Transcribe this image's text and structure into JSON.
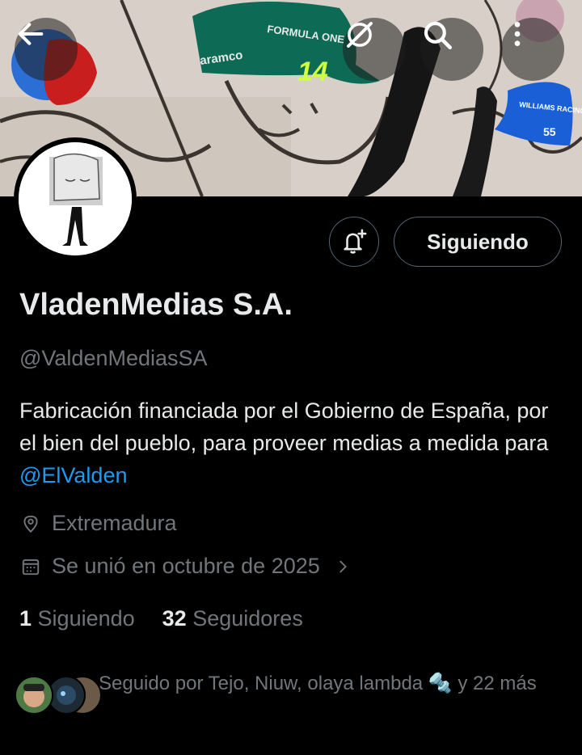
{
  "header": {
    "back_icon": "arrow-left-icon",
    "grok_icon": "grok-icon",
    "search_icon": "search-icon",
    "more_icon": "more-vertical-icon"
  },
  "banner": {
    "cap_text": "FORMULA ONE",
    "cap_sponsor": "aramco",
    "cap_number": "14",
    "williams_cap_text": "WILLIAMS RACING",
    "williams_number": "55"
  },
  "profile": {
    "notify_icon": "bell-plus-icon",
    "follow_button_label": "Siguiendo",
    "display_name": "VladenMedias S.A.",
    "handle": "@ValdenMediasSA",
    "bio_text": "Fabricación financiada por el Gobierno de España, por el bien del pueblo, para proveer medias a medida para ",
    "bio_mention": "@ElValden",
    "location": "Extremadura",
    "joined": "Se unió en octubre de 2025",
    "following_count": "1",
    "following_label": "Siguiendo",
    "followers_count": "32",
    "followers_label": "Seguidores",
    "followed_by_text": "Seguido por Tejo, Niuw, olaya lambda 🔩 y 22 más"
  },
  "colors": {
    "background": "#000000",
    "text_primary": "#e7e9ea",
    "text_secondary": "#71767b",
    "link": "#1d9bf0",
    "border": "#536471"
  }
}
